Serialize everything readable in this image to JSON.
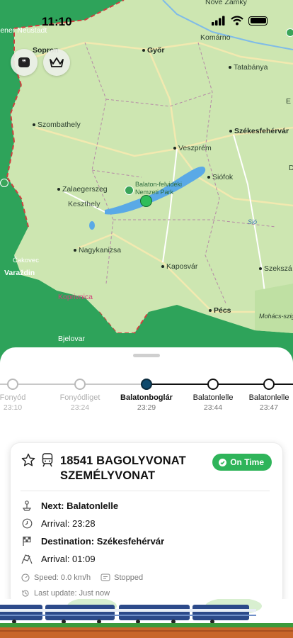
{
  "status": {
    "time": "11:10"
  },
  "map": {
    "cities": {
      "nove_zamky": "Nové Zámky",
      "wiener_neustadt": "iener Neustadt",
      "sopron": "Sopron",
      "gyor": "Győr",
      "komarno": "Komárno",
      "tatabanya": "Tatabánya",
      "szombathely": "Szombathely",
      "szekesfehervar": "Székesfehérvár",
      "veszprem": "Veszprém",
      "siofok": "Siófok",
      "zalaegerszeg": "Zalaegerszeg",
      "keszthely": "Keszthely",
      "park": "Balaton-felvidéki Nemzeti Park",
      "nagykanizsa": "Nagykanizsa",
      "cakovec": "Čakovec",
      "varazdin": "Varaždin",
      "kaposvar": "Kaposvár",
      "koprivnica": "Koprivnica",
      "pecs": "Pécs",
      "mohacs": "Mohács-sziget",
      "bjelovar": "Bjelovar",
      "szekszard": "Szekszá",
      "sio": "Sió",
      "edge_e": "E",
      "edge_d": "D"
    },
    "buttons": {
      "quote_icon": "quote-icon",
      "crown_icon": "crown-icon"
    }
  },
  "timeline": {
    "stops": [
      {
        "name": "Fonyód",
        "time": "23:10",
        "state": "past"
      },
      {
        "name": "Fonyódliget",
        "time": "23:24",
        "state": "past"
      },
      {
        "name": "Balatonboglár",
        "time": "23:29",
        "state": "current"
      },
      {
        "name": "Balatonlelle",
        "time": "23:44",
        "state": "upcoming"
      },
      {
        "name": "Balatonlelle",
        "time": "23:47",
        "state": "upcoming"
      }
    ]
  },
  "train": {
    "title": "18541 BAGOLYVONAT SZEMÉLYVONAT",
    "status_badge": "On Time",
    "next": "Next: Balatonlelle",
    "arrival_next": "Arrival: 23:28",
    "destination": "Destination: Székesfehérvár",
    "arrival_dest": "Arrival: 01:09",
    "speed": "Speed: 0.0 km/h",
    "motion": "Stopped",
    "last_update": "Last update: Just now"
  },
  "colors": {
    "accent_green": "#2fb45a",
    "current_stop": "#0f4a6d",
    "map_land": "#cfe8b4",
    "lake": "#5aa9e6"
  }
}
